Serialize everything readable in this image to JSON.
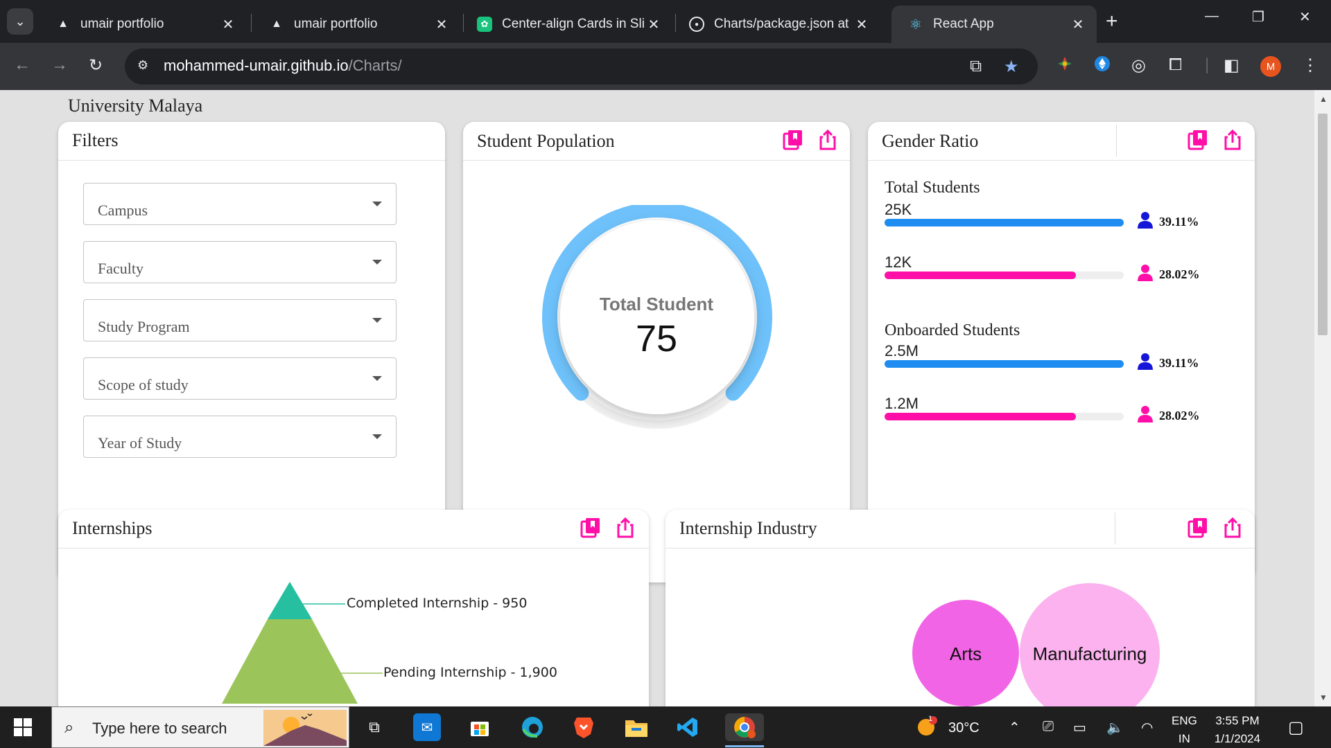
{
  "browser": {
    "tabs": [
      {
        "label": "umair portfolio",
        "icon": "triangle-icon",
        "active": false
      },
      {
        "label": "umair portfolio",
        "icon": "triangle-icon",
        "active": false
      },
      {
        "label": "Center-align Cards in Slic",
        "icon": "chatgpt-icon",
        "active": false
      },
      {
        "label": "Charts/package.json at m",
        "icon": "github-icon",
        "active": false
      },
      {
        "label": "React App",
        "icon": "react-icon",
        "active": true
      }
    ],
    "url_host": "mohammed-umair.github.io",
    "url_path": "/Charts/",
    "profile_initial": "M"
  },
  "page": {
    "org_name": "University Malaya",
    "filters": {
      "title": "Filters",
      "items": [
        "Campus",
        "Faculty",
        "Study Program",
        "Scope of study",
        "Year of Study"
      ]
    },
    "population": {
      "title": "Student Population",
      "label": "Total Student",
      "value": "75"
    },
    "gender": {
      "title": "Gender Ratio",
      "total_title": "Total Students",
      "onboarded_title": "Onboarded Students",
      "total_male_value": "25K",
      "total_female_value": "12K",
      "onboarded_male_value": "2.5M",
      "onboarded_female_value": "1.2M",
      "male_pct": "39.11%",
      "female_pct": "28.02%",
      "male_fill": 1.0,
      "female_fill": 0.8,
      "male_color": "#1e8cf0",
      "female_color": "#ff0fa8"
    },
    "internships": {
      "title": "Internships",
      "levels": [
        "Completed Internship - 950",
        "Pending Internship - 1,900"
      ]
    },
    "industry": {
      "title": "Internship Industry",
      "bubbles": [
        "Arts",
        "Manufacturing"
      ]
    },
    "accent": "#ff0fa8"
  },
  "taskbar": {
    "search_placeholder": "Type here to search",
    "weather": "30°C",
    "lang_top": "ENG",
    "lang_bottom": "IN",
    "time": "3:55 PM",
    "date": "1/1/2024",
    "weather_badge": "1"
  }
}
